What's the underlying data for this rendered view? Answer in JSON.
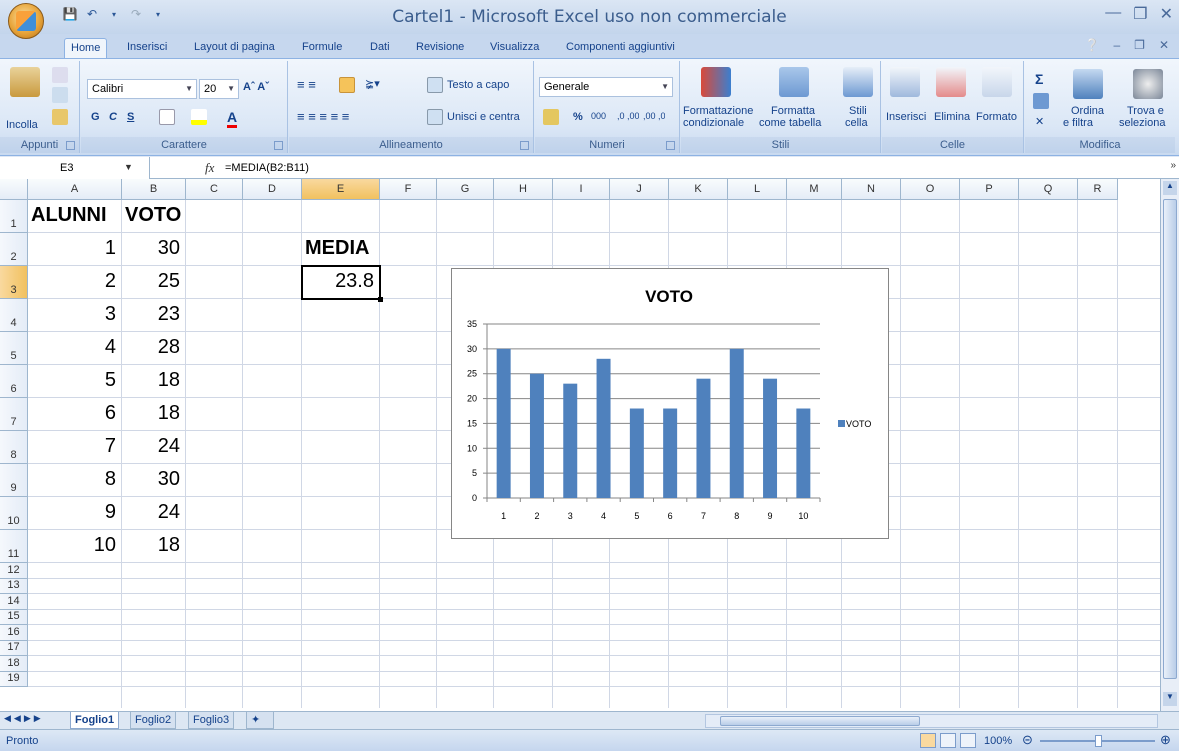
{
  "window": {
    "title": "Cartel1 - Microsoft Excel uso non commerciale"
  },
  "ribbon_tabs": [
    "Home",
    "Inserisci",
    "Layout di pagina",
    "Formule",
    "Dati",
    "Revisione",
    "Visualizza",
    "Componenti aggiuntivi"
  ],
  "ribbon": {
    "appunti": {
      "label": "Appunti",
      "incolla": "Incolla"
    },
    "carattere": {
      "label": "Carattere",
      "font": "Calibri",
      "size": "20",
      "bold": "G",
      "italic": "C",
      "underline": "S"
    },
    "allineamento": {
      "label": "Allineamento",
      "testo_a_capo": "Testo a capo",
      "unisci": "Unisci e centra"
    },
    "numeri": {
      "label": "Numeri",
      "format": "Generale",
      "percent": "%",
      "thousands": "000",
      "inc_dec": ",0 ,00",
      "dec_dec": ",00 ,0"
    },
    "stili": {
      "label": "Stili",
      "formattazione": "Formattazione",
      "condizionale": "condizionale",
      "formatta": "Formatta",
      "come_tabella": "come tabella",
      "stili_cella_1": "Stili",
      "stili_cella_2": "cella"
    },
    "celle": {
      "label": "Celle",
      "inserisci": "Inserisci",
      "elimina": "Elimina",
      "formato": "Formato"
    },
    "modifica": {
      "label": "Modifica",
      "ordina_1": "Ordina",
      "ordina_2": "e filtra",
      "trova_1": "Trova e",
      "trova_2": "seleziona"
    }
  },
  "formula_bar": {
    "name_box": "E3",
    "fx": "fx",
    "formula": "=MEDIA(B2:B11)"
  },
  "columns": [
    "A",
    "B",
    "C",
    "D",
    "E",
    "F",
    "G",
    "H",
    "I",
    "J",
    "K",
    "L",
    "M",
    "N",
    "O",
    "P",
    "Q",
    "R"
  ],
  "rows": [
    "1",
    "2",
    "3",
    "4",
    "5",
    "6",
    "7",
    "8",
    "9",
    "10",
    "11",
    "12",
    "13",
    "14",
    "15",
    "16",
    "17",
    "18",
    "19"
  ],
  "cells": {
    "A1": "ALUNNI",
    "B1": "VOTO",
    "A2": "1",
    "B2": "30",
    "A3": "2",
    "B3": "25",
    "A4": "3",
    "B4": "23",
    "A5": "4",
    "B5": "28",
    "A6": "5",
    "B6": "18",
    "A7": "6",
    "B7": "18",
    "A8": "7",
    "B8": "24",
    "A9": "8",
    "B9": "30",
    "A10": "9",
    "B10": "24",
    "A11": "10",
    "B11": "18",
    "E2": "MEDIA",
    "E3": "23.8"
  },
  "chart_data": {
    "type": "bar",
    "title": "VOTO",
    "categories": [
      "1",
      "2",
      "3",
      "4",
      "5",
      "6",
      "7",
      "8",
      "9",
      "10"
    ],
    "series": [
      {
        "name": "VOTO",
        "values": [
          30,
          25,
          23,
          28,
          18,
          18,
          24,
          30,
          24,
          18
        ],
        "color": "#4f81bd"
      }
    ],
    "ylim": [
      0,
      35
    ],
    "yticks": [
      "0",
      "5",
      "10",
      "15",
      "20",
      "25",
      "30",
      "35"
    ],
    "grid": true,
    "legend": "right"
  },
  "sheets": [
    "Foglio1",
    "Foglio2",
    "Foglio3"
  ],
  "active_sheet": "Foglio1",
  "status": {
    "text": "Pronto",
    "zoom": "100%"
  }
}
